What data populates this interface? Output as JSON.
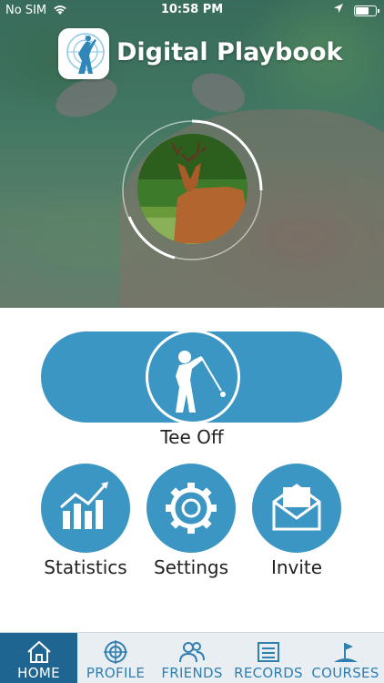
{
  "status_bar": {
    "carrier": "No SIM",
    "time": "10:58 PM"
  },
  "header": {
    "title": "Digital Playbook"
  },
  "main": {
    "tee_off_label": "Tee Off",
    "actions": [
      {
        "label": "Statistics",
        "icon": "chart-icon"
      },
      {
        "label": "Settings",
        "icon": "gear-icon"
      },
      {
        "label": "Invite",
        "icon": "envelope-icon"
      }
    ]
  },
  "tabbar": {
    "tabs": [
      {
        "label": "HOME",
        "icon": "home-icon",
        "active": true
      },
      {
        "label": "PROFILE",
        "icon": "target-icon",
        "active": false
      },
      {
        "label": "FRIENDS",
        "icon": "friends-icon",
        "active": false
      },
      {
        "label": "RECORDS",
        "icon": "records-icon",
        "active": false
      },
      {
        "label": "COURSES",
        "icon": "course-flag-icon",
        "active": false
      }
    ]
  },
  "colors": {
    "accent": "#3b96c4",
    "tab_active": "#1f6591",
    "tab_bar_bg": "#e9eef2"
  }
}
